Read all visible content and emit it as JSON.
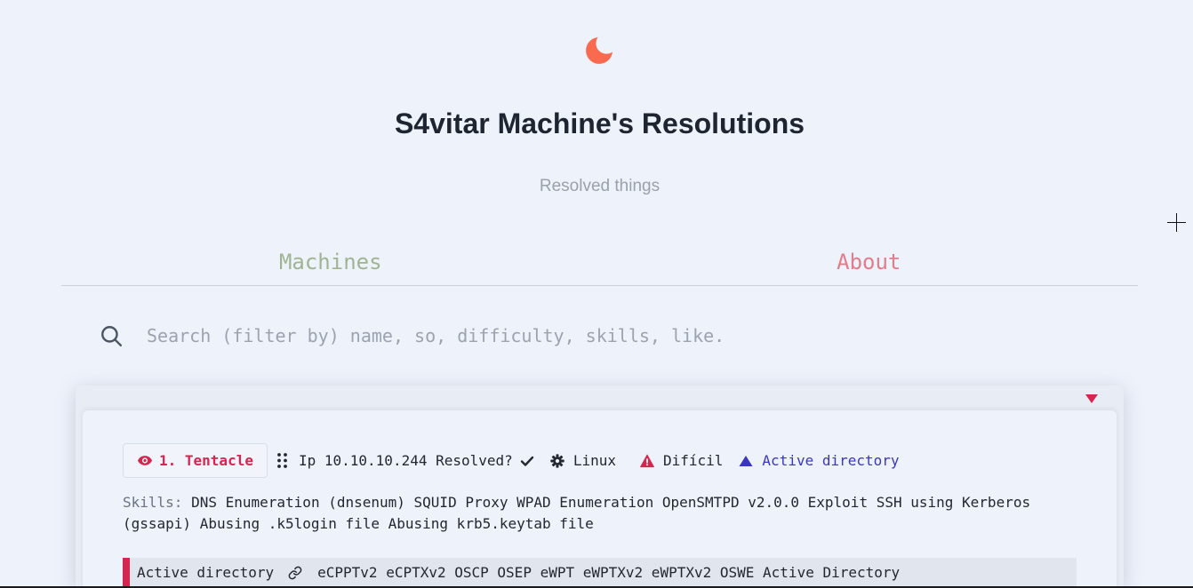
{
  "app": {
    "logo_icon": "moon-icon",
    "title": "S4vitar Machine's Resolutions",
    "subtitle": "Resolved things"
  },
  "tabs": [
    {
      "label": "Machines"
    },
    {
      "label": "About"
    }
  ],
  "search": {
    "icon": "search-icon",
    "placeholder": "Search (filter by) name, so, difficulty, skills, like.",
    "value": ""
  },
  "machines": [
    {
      "name": "1. Tentacle",
      "ip_label": "Ip",
      "ip": "10.10.10.244",
      "resolved_label": "Resolved?",
      "resolved": true,
      "os": "Linux",
      "difficulty": "Difícil",
      "category": "Active directory",
      "skills_label": "Skills:",
      "skills": "DNS Enumeration (dnsenum) SQUID Proxy WPAD Enumeration OpenSMTPD v2.0.0 Exploit SSH using Kerberos (gssapi) Abusing .k5login file Abusing krb5.keytab file",
      "footer_category": "Active directory",
      "certifications": "eCPPTv2 eCPTXv2 OSCP OSEP eWPT eWPTXv2 eWPTXv2 OSWE Active Directory"
    }
  ],
  "icons": {
    "name_badge": "eye-icon",
    "reorder": "drag-handle-icon",
    "resolved": "check-icon",
    "os": "gear-icon",
    "difficulty": "warning-icon",
    "category": "triangle-up-icon",
    "collapse": "caret-down-icon",
    "footer_link": "link-icon"
  },
  "colors": {
    "page_background": "#eef2fb",
    "logo": "#f96a4f",
    "machines_tab": "#9fb592",
    "about_tab": "#e27c8b",
    "accent_red": "#d6264f",
    "category_blue": "#3a36c0",
    "text": "#232830",
    "muted": "#6b7280"
  }
}
